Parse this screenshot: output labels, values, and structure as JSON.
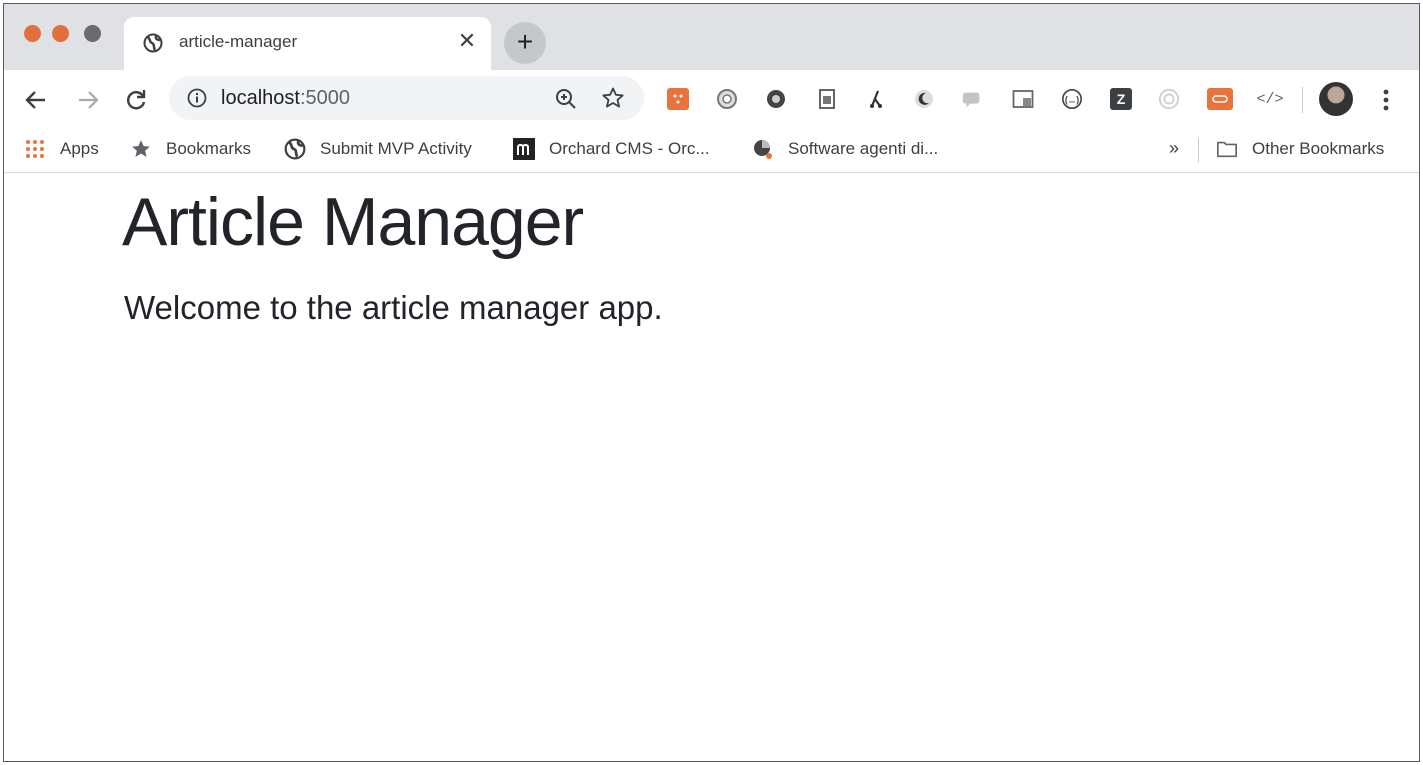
{
  "browser": {
    "tab": {
      "title": "article-manager",
      "close_glyph": "✕",
      "favicon": "globe-icon"
    },
    "new_tab_glyph": "+",
    "address_bar": {
      "host": "localhost",
      "port": ":5000"
    },
    "extension_icons": [
      "orange-square-extension-icon",
      "circle-extension-icon",
      "dark-circle-extension-icon",
      "page-extension-icon",
      "branch-extension-icon",
      "moon-extension-icon",
      "chat-extension-icon",
      "window-extension-icon",
      "braces-extension-icon",
      "z-extension-icon",
      "target-extension-icon",
      "orange-badge-extension-icon",
      "code-extension-icon"
    ],
    "extension_z_label": "Z",
    "extension_code_label": "</>"
  },
  "bookmarks_bar": {
    "items": [
      {
        "label": "Apps",
        "icon": "apps-grid-icon"
      },
      {
        "label": "Bookmarks",
        "icon": "star-icon"
      },
      {
        "label": "Submit MVP Activity",
        "icon": "globe-icon"
      },
      {
        "label": "Orchard CMS - Orc...",
        "icon": "m-logo-icon"
      },
      {
        "label": "Software agenti di...",
        "icon": "pie-chart-icon"
      }
    ],
    "overflow_glyph": "»",
    "other_bookmarks": "Other Bookmarks"
  },
  "page": {
    "title": "Article Manager",
    "lead": "Welcome to the article manager app."
  },
  "colors": {
    "traffic_light": "#e2703e",
    "tab_strip": "#dfe1e5",
    "text": "#212529",
    "extension_orange": "#e8733c"
  }
}
